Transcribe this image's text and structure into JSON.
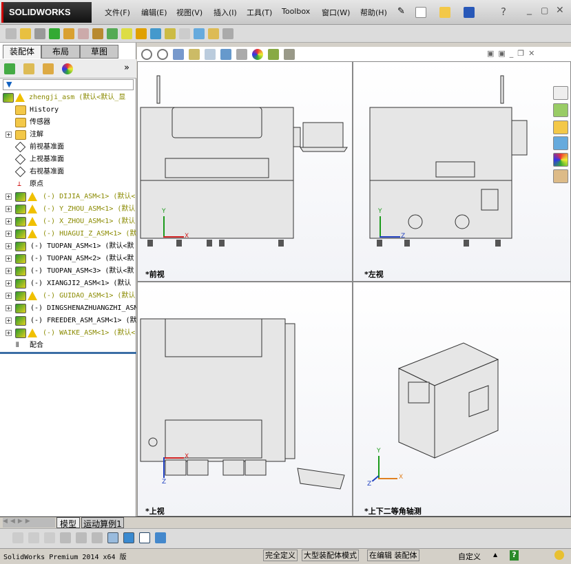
{
  "app": {
    "logo": "SOLIDWORKS"
  },
  "menu": [
    "文件(F)",
    "编辑(E)",
    "视图(V)",
    "插入(I)",
    "工具(T)",
    "Toolbox",
    "窗口(W)",
    "帮助(H)"
  ],
  "left_panel": {
    "tabs": [
      "装配体",
      "布局",
      "草图"
    ],
    "tree": [
      {
        "label": "zhengji_asm  (默认<默认_显",
        "type": "root",
        "warn": true
      },
      {
        "label": "History",
        "type": "folder"
      },
      {
        "label": "传感器",
        "type": "folder"
      },
      {
        "label": "注解",
        "type": "folder",
        "expand": true
      },
      {
        "label": "前视基准面",
        "type": "plane"
      },
      {
        "label": "上视基准面",
        "type": "plane"
      },
      {
        "label": "右视基准面",
        "type": "plane"
      },
      {
        "label": "原点",
        "type": "origin"
      },
      {
        "label": "(-) DIJIA_ASM<1> (默认<",
        "type": "asm",
        "warn": true
      },
      {
        "label": "(-) Y_ZHOU_ASM<1> (默认",
        "type": "asm",
        "warn": true
      },
      {
        "label": "(-) X_ZHOU_ASM<1> (默认",
        "type": "asm",
        "warn": true
      },
      {
        "label": "(-) HUAGUI_Z_ASM<1> (默",
        "type": "asm",
        "warn": true
      },
      {
        "label": "(-) TUOPAN_ASM<1> (默认<默",
        "type": "asm"
      },
      {
        "label": "(-) TUOPAN_ASM<2> (默认<默",
        "type": "asm"
      },
      {
        "label": "(-) TUOPAN_ASM<3> (默认<默",
        "type": "asm"
      },
      {
        "label": "(-) XIANGJI2_ASM<1> (默认",
        "type": "asm"
      },
      {
        "label": "(-) GUIDAO_ASM<1> (默认",
        "type": "asm",
        "warn": true
      },
      {
        "label": "(-) DINGSHENAZHUANGZHI_ASM",
        "type": "asm"
      },
      {
        "label": "(-) FREEDER_ASM_ASM<1> (默",
        "type": "asm"
      },
      {
        "label": "(-) WAIKE_ASM<1> (默认<",
        "type": "asm",
        "warn": true
      },
      {
        "label": "配合",
        "type": "mates"
      }
    ]
  },
  "viewports": [
    "*前视",
    "*左视",
    "*上视",
    "*上下二等角轴测"
  ],
  "axes": {
    "x": "X",
    "y": "Y",
    "z": "Z"
  },
  "bottom_tabs": [
    "模型",
    "运动算例1"
  ],
  "status": {
    "product": "SolidWorks Premium 2014 x64 版",
    "s1": "完全定义",
    "s2": "大型装配体模式",
    "s3": "在编辑 装配体",
    "s4": "自定义",
    "help": "?"
  },
  "colors": {
    "warn": "#f0c000",
    "dim_text": "#8a8a00",
    "selection_blue": "#1060c0"
  }
}
